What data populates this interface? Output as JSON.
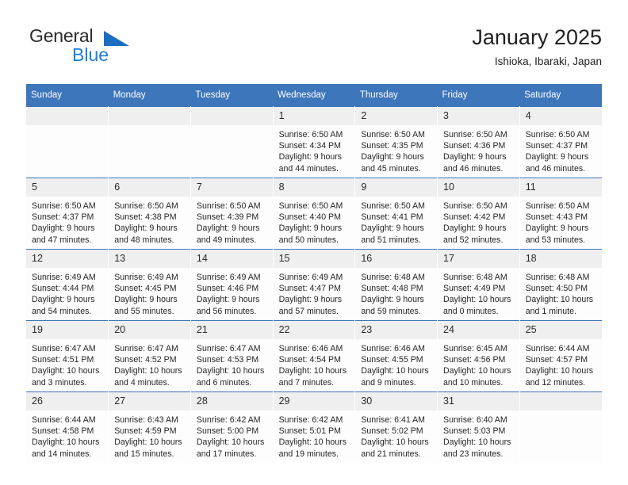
{
  "brand": {
    "name_top": "General",
    "name_bottom": "Blue",
    "triangle_icon": "triangle-icon"
  },
  "header": {
    "title": "January 2025",
    "location": "Ishioka, Ibaraki, Japan"
  },
  "colors": {
    "header_blue": "#3d76bb",
    "brand_blue": "#1b7fd4",
    "daynum_bg": "#efefef",
    "cell_bg": "#fdfdfd"
  },
  "calendar": {
    "weekdays": [
      "Sunday",
      "Monday",
      "Tuesday",
      "Wednesday",
      "Thursday",
      "Friday",
      "Saturday"
    ],
    "weeks": [
      [
        {
          "day": "",
          "sunrise": "",
          "sunset": "",
          "daylight1": "",
          "daylight2": ""
        },
        {
          "day": "",
          "sunrise": "",
          "sunset": "",
          "daylight1": "",
          "daylight2": ""
        },
        {
          "day": "",
          "sunrise": "",
          "sunset": "",
          "daylight1": "",
          "daylight2": ""
        },
        {
          "day": "1",
          "sunrise": "Sunrise: 6:50 AM",
          "sunset": "Sunset: 4:34 PM",
          "daylight1": "Daylight: 9 hours",
          "daylight2": "and 44 minutes."
        },
        {
          "day": "2",
          "sunrise": "Sunrise: 6:50 AM",
          "sunset": "Sunset: 4:35 PM",
          "daylight1": "Daylight: 9 hours",
          "daylight2": "and 45 minutes."
        },
        {
          "day": "3",
          "sunrise": "Sunrise: 6:50 AM",
          "sunset": "Sunset: 4:36 PM",
          "daylight1": "Daylight: 9 hours",
          "daylight2": "and 46 minutes."
        },
        {
          "day": "4",
          "sunrise": "Sunrise: 6:50 AM",
          "sunset": "Sunset: 4:37 PM",
          "daylight1": "Daylight: 9 hours",
          "daylight2": "and 46 minutes."
        }
      ],
      [
        {
          "day": "5",
          "sunrise": "Sunrise: 6:50 AM",
          "sunset": "Sunset: 4:37 PM",
          "daylight1": "Daylight: 9 hours",
          "daylight2": "and 47 minutes."
        },
        {
          "day": "6",
          "sunrise": "Sunrise: 6:50 AM",
          "sunset": "Sunset: 4:38 PM",
          "daylight1": "Daylight: 9 hours",
          "daylight2": "and 48 minutes."
        },
        {
          "day": "7",
          "sunrise": "Sunrise: 6:50 AM",
          "sunset": "Sunset: 4:39 PM",
          "daylight1": "Daylight: 9 hours",
          "daylight2": "and 49 minutes."
        },
        {
          "day": "8",
          "sunrise": "Sunrise: 6:50 AM",
          "sunset": "Sunset: 4:40 PM",
          "daylight1": "Daylight: 9 hours",
          "daylight2": "and 50 minutes."
        },
        {
          "day": "9",
          "sunrise": "Sunrise: 6:50 AM",
          "sunset": "Sunset: 4:41 PM",
          "daylight1": "Daylight: 9 hours",
          "daylight2": "and 51 minutes."
        },
        {
          "day": "10",
          "sunrise": "Sunrise: 6:50 AM",
          "sunset": "Sunset: 4:42 PM",
          "daylight1": "Daylight: 9 hours",
          "daylight2": "and 52 minutes."
        },
        {
          "day": "11",
          "sunrise": "Sunrise: 6:50 AM",
          "sunset": "Sunset: 4:43 PM",
          "daylight1": "Daylight: 9 hours",
          "daylight2": "and 53 minutes."
        }
      ],
      [
        {
          "day": "12",
          "sunrise": "Sunrise: 6:49 AM",
          "sunset": "Sunset: 4:44 PM",
          "daylight1": "Daylight: 9 hours",
          "daylight2": "and 54 minutes."
        },
        {
          "day": "13",
          "sunrise": "Sunrise: 6:49 AM",
          "sunset": "Sunset: 4:45 PM",
          "daylight1": "Daylight: 9 hours",
          "daylight2": "and 55 minutes."
        },
        {
          "day": "14",
          "sunrise": "Sunrise: 6:49 AM",
          "sunset": "Sunset: 4:46 PM",
          "daylight1": "Daylight: 9 hours",
          "daylight2": "and 56 minutes."
        },
        {
          "day": "15",
          "sunrise": "Sunrise: 6:49 AM",
          "sunset": "Sunset: 4:47 PM",
          "daylight1": "Daylight: 9 hours",
          "daylight2": "and 57 minutes."
        },
        {
          "day": "16",
          "sunrise": "Sunrise: 6:48 AM",
          "sunset": "Sunset: 4:48 PM",
          "daylight1": "Daylight: 9 hours",
          "daylight2": "and 59 minutes."
        },
        {
          "day": "17",
          "sunrise": "Sunrise: 6:48 AM",
          "sunset": "Sunset: 4:49 PM",
          "daylight1": "Daylight: 10 hours",
          "daylight2": "and 0 minutes."
        },
        {
          "day": "18",
          "sunrise": "Sunrise: 6:48 AM",
          "sunset": "Sunset: 4:50 PM",
          "daylight1": "Daylight: 10 hours",
          "daylight2": "and 1 minute."
        }
      ],
      [
        {
          "day": "19",
          "sunrise": "Sunrise: 6:47 AM",
          "sunset": "Sunset: 4:51 PM",
          "daylight1": "Daylight: 10 hours",
          "daylight2": "and 3 minutes."
        },
        {
          "day": "20",
          "sunrise": "Sunrise: 6:47 AM",
          "sunset": "Sunset: 4:52 PM",
          "daylight1": "Daylight: 10 hours",
          "daylight2": "and 4 minutes."
        },
        {
          "day": "21",
          "sunrise": "Sunrise: 6:47 AM",
          "sunset": "Sunset: 4:53 PM",
          "daylight1": "Daylight: 10 hours",
          "daylight2": "and 6 minutes."
        },
        {
          "day": "22",
          "sunrise": "Sunrise: 6:46 AM",
          "sunset": "Sunset: 4:54 PM",
          "daylight1": "Daylight: 10 hours",
          "daylight2": "and 7 minutes."
        },
        {
          "day": "23",
          "sunrise": "Sunrise: 6:46 AM",
          "sunset": "Sunset: 4:55 PM",
          "daylight1": "Daylight: 10 hours",
          "daylight2": "and 9 minutes."
        },
        {
          "day": "24",
          "sunrise": "Sunrise: 6:45 AM",
          "sunset": "Sunset: 4:56 PM",
          "daylight1": "Daylight: 10 hours",
          "daylight2": "and 10 minutes."
        },
        {
          "day": "25",
          "sunrise": "Sunrise: 6:44 AM",
          "sunset": "Sunset: 4:57 PM",
          "daylight1": "Daylight: 10 hours",
          "daylight2": "and 12 minutes."
        }
      ],
      [
        {
          "day": "26",
          "sunrise": "Sunrise: 6:44 AM",
          "sunset": "Sunset: 4:58 PM",
          "daylight1": "Daylight: 10 hours",
          "daylight2": "and 14 minutes."
        },
        {
          "day": "27",
          "sunrise": "Sunrise: 6:43 AM",
          "sunset": "Sunset: 4:59 PM",
          "daylight1": "Daylight: 10 hours",
          "daylight2": "and 15 minutes."
        },
        {
          "day": "28",
          "sunrise": "Sunrise: 6:42 AM",
          "sunset": "Sunset: 5:00 PM",
          "daylight1": "Daylight: 10 hours",
          "daylight2": "and 17 minutes."
        },
        {
          "day": "29",
          "sunrise": "Sunrise: 6:42 AM",
          "sunset": "Sunset: 5:01 PM",
          "daylight1": "Daylight: 10 hours",
          "daylight2": "and 19 minutes."
        },
        {
          "day": "30",
          "sunrise": "Sunrise: 6:41 AM",
          "sunset": "Sunset: 5:02 PM",
          "daylight1": "Daylight: 10 hours",
          "daylight2": "and 21 minutes."
        },
        {
          "day": "31",
          "sunrise": "Sunrise: 6:40 AM",
          "sunset": "Sunset: 5:03 PM",
          "daylight1": "Daylight: 10 hours",
          "daylight2": "and 23 minutes."
        },
        {
          "day": "",
          "sunrise": "",
          "sunset": "",
          "daylight1": "",
          "daylight2": ""
        }
      ]
    ]
  }
}
